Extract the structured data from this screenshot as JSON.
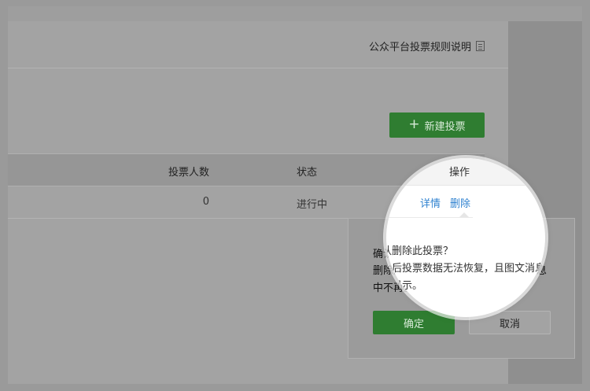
{
  "header": {
    "rules_link": "公众平台投票规则说明",
    "rules_icon": "document-icon"
  },
  "toolbar": {
    "new_vote_label": "新建投票"
  },
  "table": {
    "headers": {
      "count": "投票人数",
      "status": "状态",
      "ops": "操作"
    },
    "rows": [
      {
        "count": "0",
        "status": "进行中",
        "ops": {
          "details": "详情",
          "delete": "删除"
        }
      }
    ]
  },
  "popover": {
    "title": "确认删除此投票？",
    "desc": "删除后投票数据无法恢复，且图文消息中不再显示。",
    "confirm": "确定",
    "cancel": "取消"
  },
  "colors": {
    "primary_green": "#2f7d31",
    "link_blue": "#2f82d0"
  }
}
